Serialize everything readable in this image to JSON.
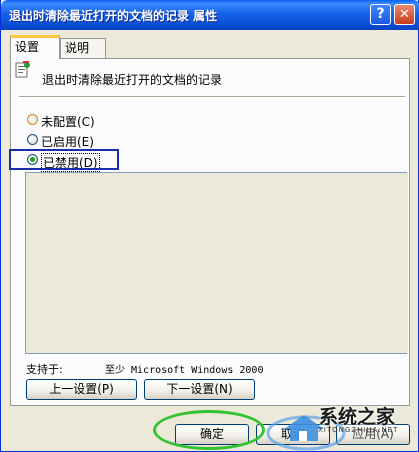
{
  "window": {
    "title": "退出时清除最近打开的文档的记录 属性",
    "help_icon": "help-icon",
    "close_icon": "close-icon"
  },
  "tabs": [
    {
      "label": "设置",
      "active": true
    },
    {
      "label": "说明",
      "active": false
    }
  ],
  "policy": {
    "icon": "policy-setting-icon",
    "title": "退出时清除最近打开的文档的记录"
  },
  "options": [
    {
      "label": "未配置(C)",
      "selected": false
    },
    {
      "label": "已启用(E)",
      "selected": false
    },
    {
      "label": "已禁用(D)",
      "selected": true
    }
  ],
  "supported": {
    "label": "支持于:",
    "value": "至少 Microsoft Windows 2000"
  },
  "nav_buttons": {
    "prev": "上一设置(P)",
    "next": "下一设置(N)"
  },
  "dialog_buttons": {
    "ok": "确定",
    "cancel": "取消",
    "apply": "应用(A)"
  },
  "watermark": {
    "text": "系统之家",
    "url": "XITONGZHIJIA.NET"
  },
  "colors": {
    "titlebar": "#0a4fd8",
    "dialog_bg": "#ece9d8",
    "annotation_box": "#1a2ea8",
    "annotation_ellipse": "#32c332"
  }
}
